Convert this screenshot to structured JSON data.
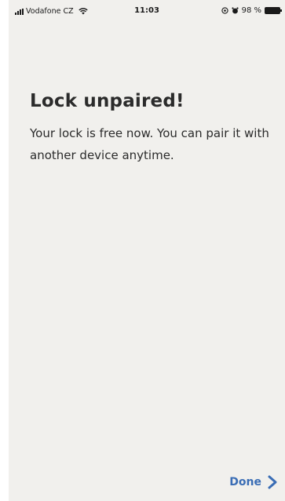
{
  "status_bar": {
    "carrier": "Vodafone CZ",
    "time": "11:03",
    "battery": "98 %",
    "icons": [
      "signal-icon",
      "wifi-icon",
      "location-icon",
      "alarm-icon",
      "battery-icon"
    ]
  },
  "main": {
    "title": "Lock unpaired!",
    "message": "Your lock is free now. You can pair it with another device anytime."
  },
  "footer": {
    "done_label": "Done",
    "done_icon": "chevron-right-icon"
  },
  "colors": {
    "background": "#f1f0ed",
    "text": "#2b2b2b",
    "accent": "#3a6db5"
  }
}
